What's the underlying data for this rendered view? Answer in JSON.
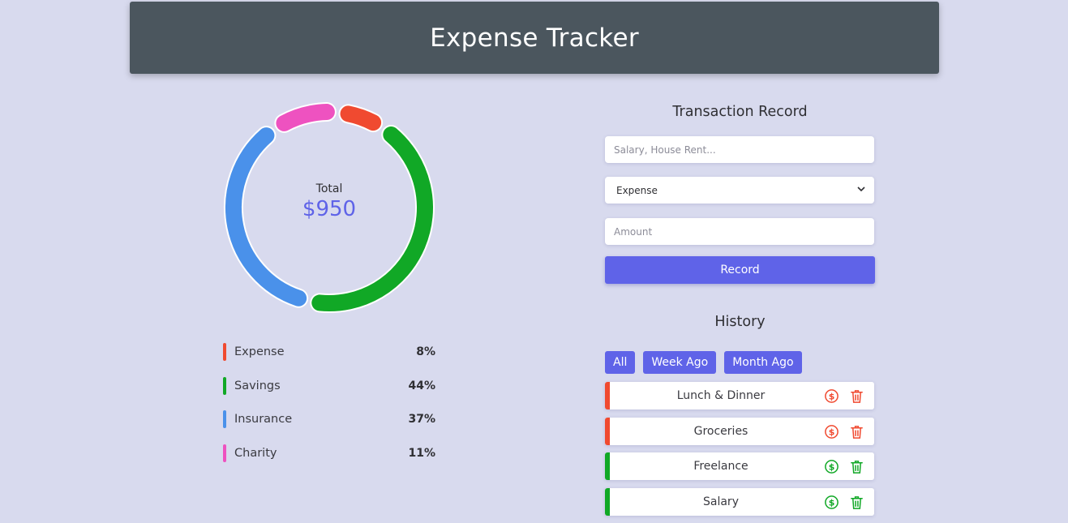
{
  "header": {
    "title": "Expense Tracker"
  },
  "summary": {
    "total_label": "Total",
    "total_value": "$950"
  },
  "colors": {
    "expense": "#f04a30",
    "savings": "#11a826",
    "insurance": "#4a91ea",
    "charity": "#ee52c0",
    "accent": "#5f63e8",
    "header_bg": "#4b565e"
  },
  "legend": [
    {
      "name": "Expense",
      "percent": "8%"
    },
    {
      "name": "Savings",
      "percent": "44%"
    },
    {
      "name": "Insurance",
      "percent": "37%"
    },
    {
      "name": "Charity",
      "percent": "11%"
    }
  ],
  "chart_data": {
    "type": "pie",
    "categories": [
      "Expense",
      "Savings",
      "Insurance",
      "Charity"
    ],
    "values": [
      8,
      44,
      37,
      11
    ],
    "colors": [
      "#f04a30",
      "#11a826",
      "#4a91ea",
      "#ee52c0"
    ]
  },
  "form": {
    "title": "Transaction Record",
    "name_placeholder": "Salary, House Rent...",
    "type_selected": "Expense",
    "amount_placeholder": "Amount",
    "record_label": "Record"
  },
  "history": {
    "title": "History",
    "filters": [
      "All",
      "Week Ago",
      "Month Ago"
    ],
    "items": [
      {
        "name": "Lunch & Dinner",
        "kind": "expense"
      },
      {
        "name": "Groceries",
        "kind": "expense"
      },
      {
        "name": "Freelance",
        "kind": "income"
      },
      {
        "name": "Salary",
        "kind": "income"
      }
    ]
  }
}
